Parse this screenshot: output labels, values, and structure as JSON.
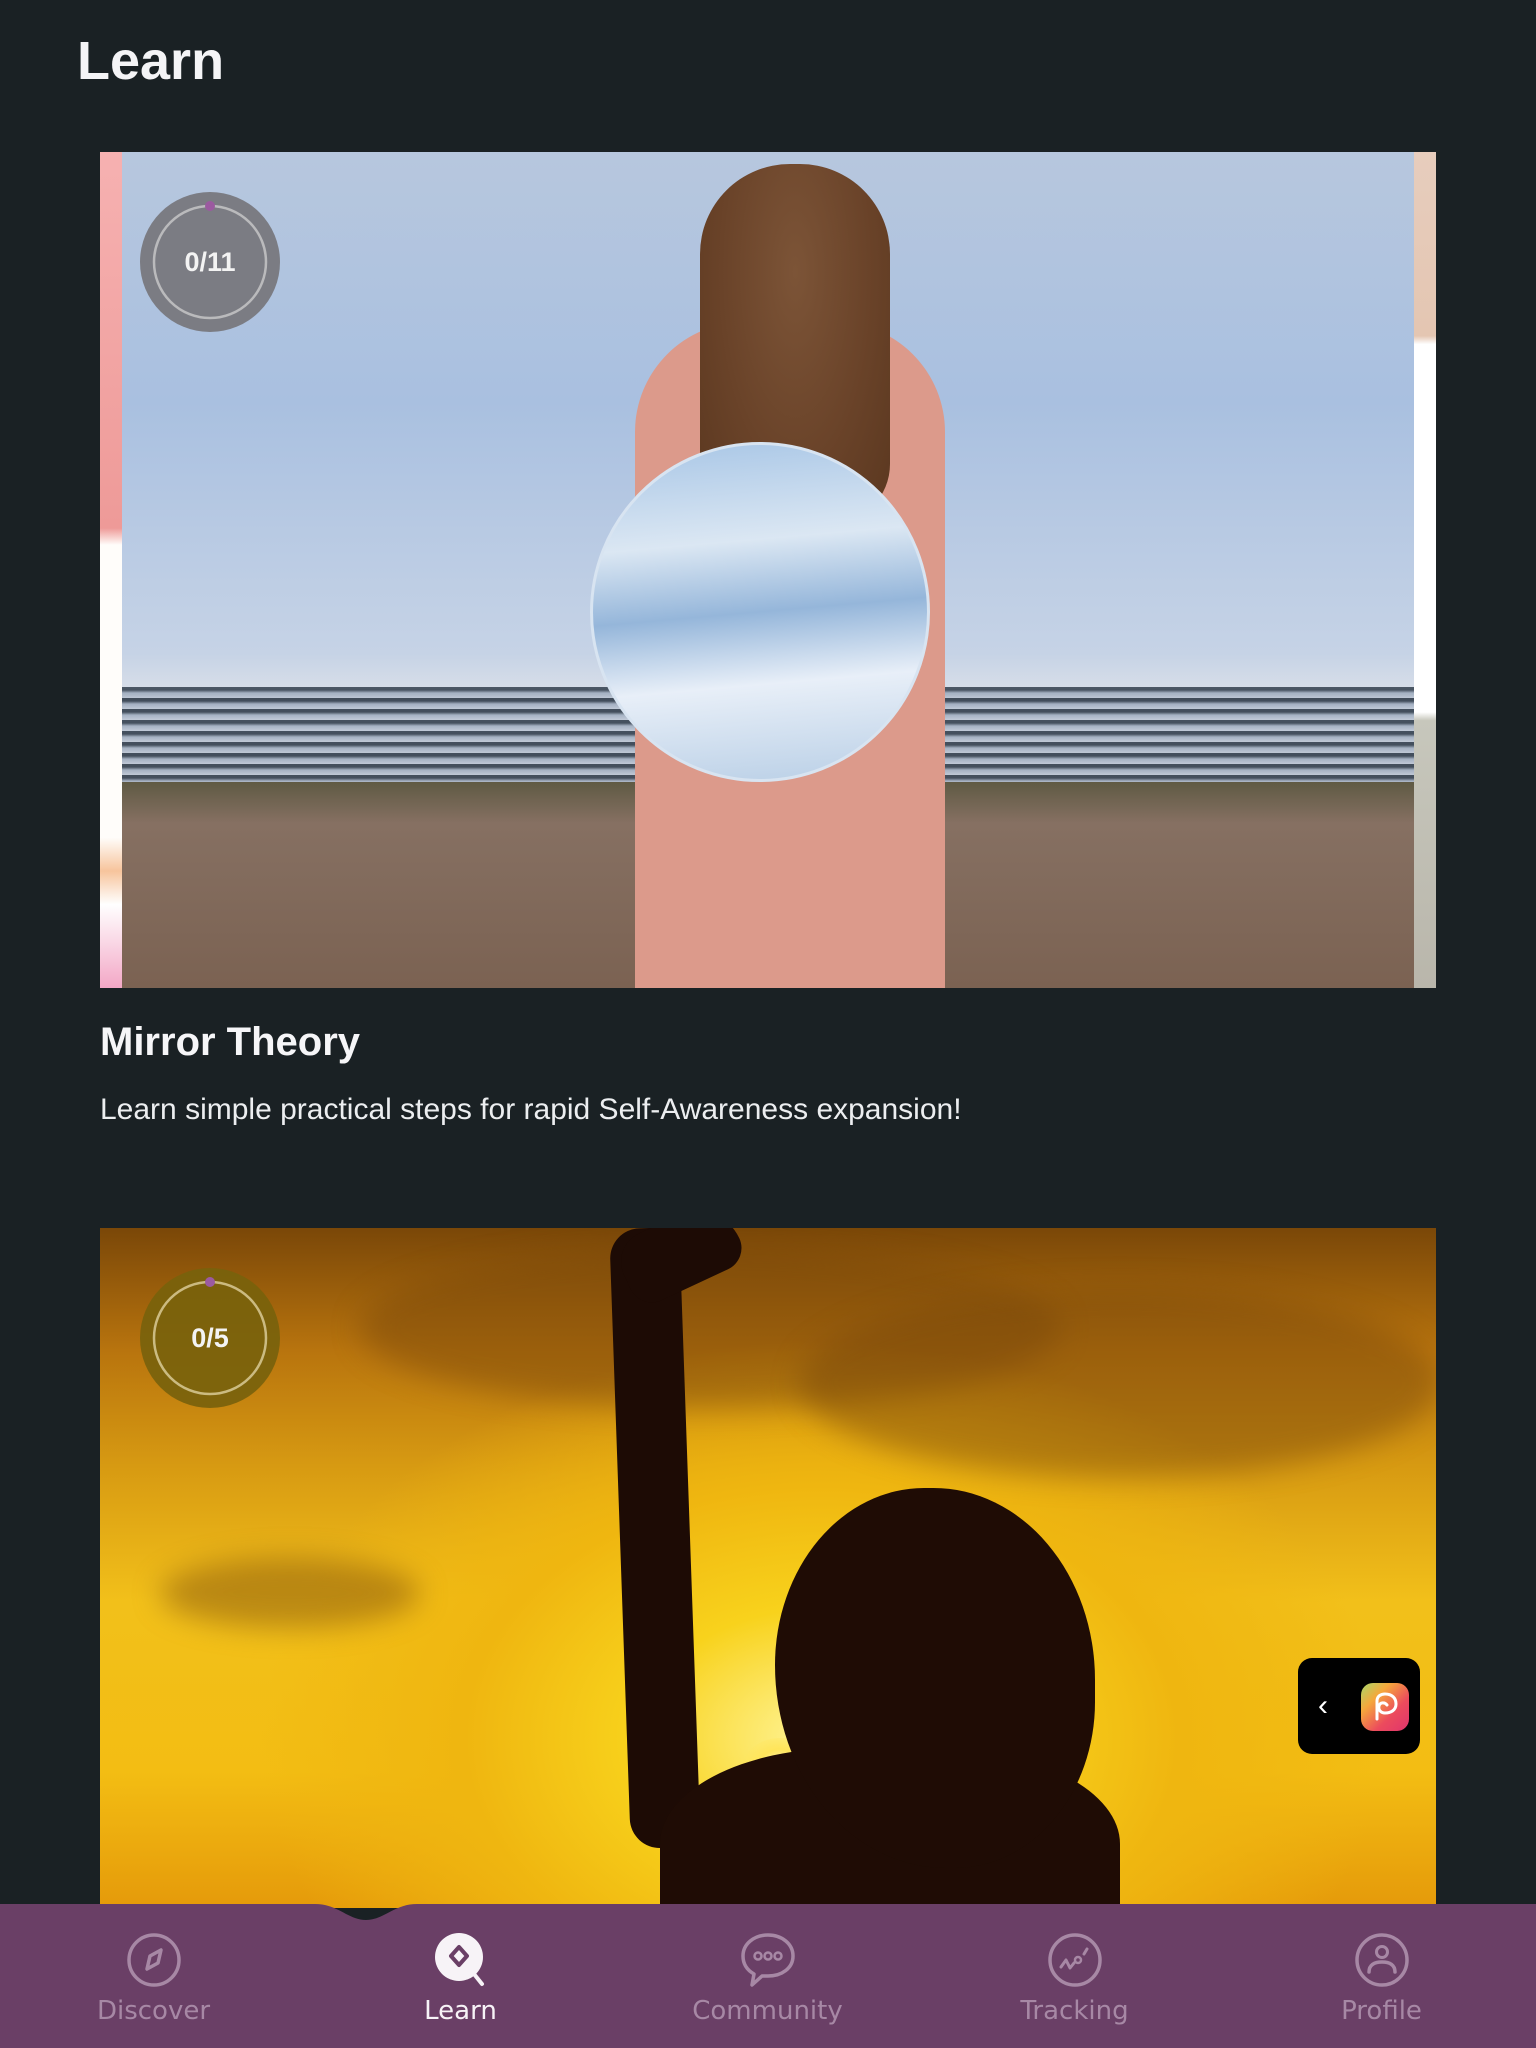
{
  "header": {
    "title": "Learn"
  },
  "courses": [
    {
      "title": "Mirror Theory",
      "description": "Learn simple practical steps for rapid Self-Awareness expansion!",
      "progress": {
        "completed": 0,
        "total": 11,
        "label": "0/11"
      },
      "image": "woman-holding-mirror-on-beach"
    },
    {
      "title": "",
      "description": "",
      "progress": {
        "completed": 0,
        "total": 5,
        "label": "0/5"
      },
      "image": "silhouette-reaching-toward-sunset"
    }
  ],
  "floating_widget": {
    "chevron": "‹",
    "icon": "app-logo-icon"
  },
  "colors": {
    "background": "#1a2124",
    "nav_background": "#6a3f66",
    "nav_inactive": "#a788a5",
    "nav_active": "#f7f3f7",
    "progress_dot": "#9b5aa0"
  },
  "bottom_nav": {
    "active": "Learn",
    "items": [
      {
        "label": "Discover",
        "icon": "compass-icon"
      },
      {
        "label": "Learn",
        "icon": "learn-search-icon"
      },
      {
        "label": "Community",
        "icon": "chat-bubble-icon"
      },
      {
        "label": "Tracking",
        "icon": "tracking-chart-icon"
      },
      {
        "label": "Profile",
        "icon": "profile-icon"
      }
    ]
  }
}
